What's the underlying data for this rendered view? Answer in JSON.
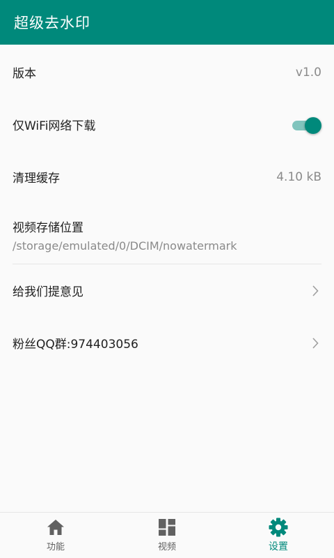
{
  "colors": {
    "primary": "#00897b",
    "switch_track": "#80c4bd",
    "text": "#212121",
    "secondary": "#8a8a8a"
  },
  "appbar": {
    "title": "超级去水印"
  },
  "settings": {
    "version": {
      "label": "版本",
      "value": "v1.0"
    },
    "wifi_only": {
      "label": "仅WiFi网络下载",
      "enabled": true
    },
    "clear_cache": {
      "label": "清理缓存",
      "value": "4.10 kB"
    },
    "storage": {
      "label": "视频存储位置",
      "path": "/storage/emulated/0/DCIM/nowatermark"
    },
    "feedback": {
      "label": "给我们提意见",
      "icon": "chevron-right-icon"
    },
    "qq_group": {
      "label": "粉丝QQ群:974403056",
      "icon": "chevron-right-icon"
    }
  },
  "bottom_nav": {
    "items": [
      {
        "label": "功能",
        "icon": "home-icon",
        "active": false
      },
      {
        "label": "视频",
        "icon": "dashboard-icon",
        "active": false
      },
      {
        "label": "设置",
        "icon": "gear-icon",
        "active": true
      }
    ]
  }
}
